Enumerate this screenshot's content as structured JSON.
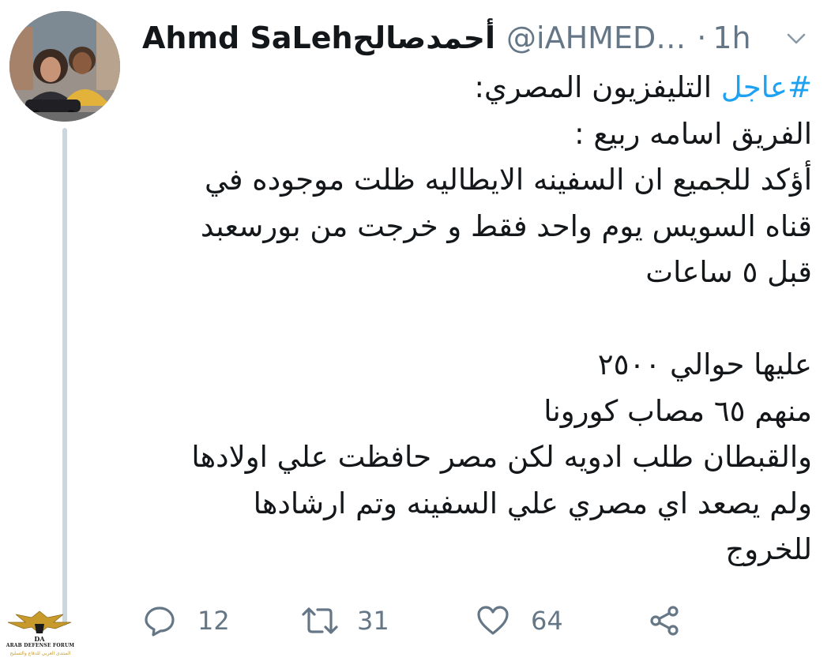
{
  "header": {
    "display_name": "Ahmd SaLehأحمدصالح",
    "handle": "@iAHMED…",
    "separator": "·",
    "time": "1h"
  },
  "tweet": {
    "lines": [
      {
        "hashtag": "#عاجل",
        "text": " التليفزيون المصري:"
      },
      {
        "text": "الفريق اسامه ربيع :"
      },
      {
        "text": "أؤكد للجميع ان السفينه الايطاليه ظلت موجوده في"
      },
      {
        "text": "قناه السويس يوم واحد فقط و خرجت من بورسعبد"
      },
      {
        "text": "قبل ٥ ساعات"
      },
      {
        "text": ""
      },
      {
        "text": "عليها حوالي ٢٥٠٠"
      },
      {
        "text": "منهم ٦٥ مصاب كورونا"
      },
      {
        "text": "والقبطان طلب ادويه لكن مصر حافظت علي اولادها"
      },
      {
        "text": "ولم يصعد اي مصري علي السفينه وتم ارشادها"
      },
      {
        "text": "للخروج"
      }
    ]
  },
  "actions": {
    "reply_count": "12",
    "retweet_count": "31",
    "like_count": "64",
    "reply_icon": "reply-icon",
    "retweet_icon": "retweet-icon",
    "like_icon": "heart-icon",
    "share_icon": "share-icon"
  },
  "watermark": {
    "brand": "DA",
    "title": "ARAB DEFENSE FORUM",
    "subtitle": "المنتدى العربي للدفاع والتسليح"
  },
  "colors": {
    "text": "#14171a",
    "secondary": "#657786",
    "link": "#1da1f2",
    "thread_line": "#ccd6dd"
  }
}
